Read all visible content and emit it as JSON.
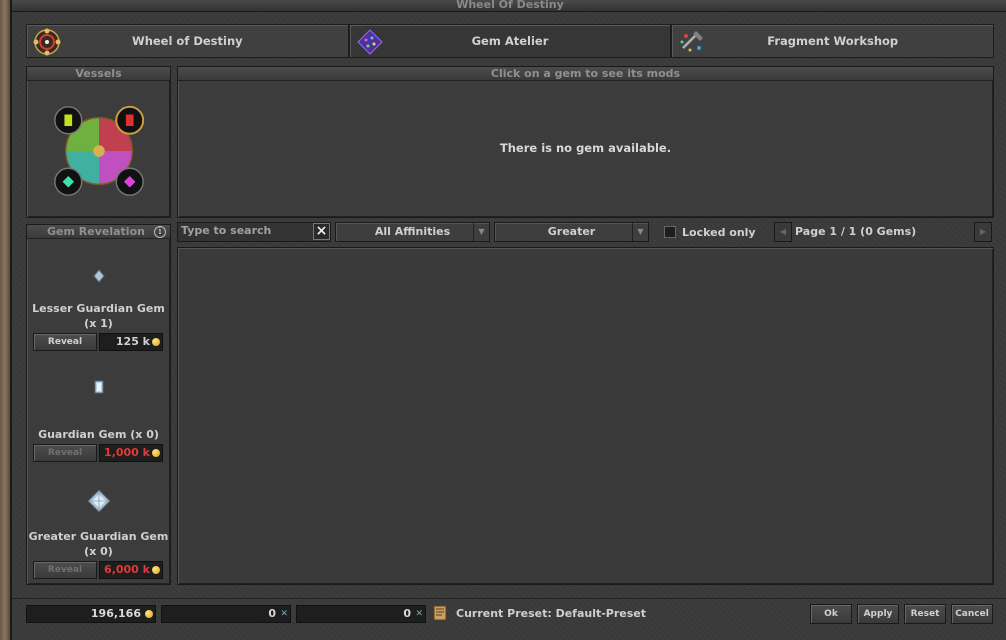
{
  "window": {
    "title": "Wheel Of Destiny"
  },
  "tabs": [
    {
      "label": "Wheel of Destiny",
      "icon": "wheel-icon"
    },
    {
      "label": "Gem Atelier",
      "icon": "gem-atelier-icon"
    },
    {
      "label": "Fragment Workshop",
      "icon": "fragment-workshop-icon"
    }
  ],
  "vessels": {
    "title": "Vessels"
  },
  "mods": {
    "title": "Click on a gem to see its mods",
    "message": "There is no gem available."
  },
  "revelation": {
    "title": "Gem Revelation",
    "items": [
      {
        "name": "Lesser Guardian Gem (x 1)",
        "button": "Reveal",
        "price": "125 k",
        "enabled": true,
        "affordable": true
      },
      {
        "name": "Guardian Gem (x 0)",
        "button": "Reveal",
        "price": "1,000 k",
        "enabled": false,
        "affordable": false
      },
      {
        "name": "Greater Guardian Gem (x 0)",
        "button": "Reveal",
        "price": "6,000 k",
        "enabled": false,
        "affordable": false
      }
    ]
  },
  "filters": {
    "search_placeholder": "Type to search",
    "affinity": "All Affinities",
    "quality": "Greater",
    "locked_label": "Locked only",
    "page": "Page 1 / 1 (0 Gems)"
  },
  "footer": {
    "gold": "196,166",
    "fragments_lesser": "0",
    "fragments_greater": "0",
    "preset": "Current Preset: Default-Preset",
    "ok": "Ok",
    "apply": "Apply",
    "reset": "Reset",
    "cancel": "Cancel"
  },
  "colors": {
    "affordable": "#d0d0d0",
    "unaffordable": "#e03a3a"
  }
}
